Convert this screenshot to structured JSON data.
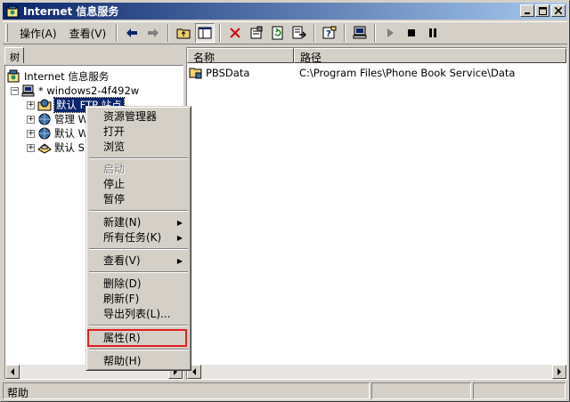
{
  "window": {
    "title": "Internet 信息服务",
    "controls": {
      "minimize": "_",
      "maximize": "□",
      "close": "×"
    }
  },
  "menu": [
    {
      "label": "操作(A)"
    },
    {
      "label": "查看(V)"
    }
  ],
  "toolbar": {
    "icons": [
      "back-arrow-icon",
      "forward-arrow-icon",
      "up-folder-icon",
      "show-tree-icon",
      "delete-icon",
      "properties-icon",
      "refresh-icon",
      "export-list-icon",
      "help-icon",
      "computer-icon",
      "play-icon",
      "stop-icon",
      "pause-icon"
    ]
  },
  "tree_pane": {
    "tab_label": "树",
    "nodes": [
      {
        "label": "Internet 信息服务"
      },
      {
        "label": "* windows2-4f492w"
      },
      {
        "label": "默认 FTP 站点"
      },
      {
        "label": "管理 W"
      },
      {
        "label": "默认 W"
      },
      {
        "label": "默认 S"
      }
    ]
  },
  "list_pane": {
    "columns": [
      "名称",
      "路径"
    ],
    "rows": [
      {
        "name": "PBSData",
        "path": "C:\\Program Files\\Phone Book Service\\Data"
      }
    ]
  },
  "context_menu": {
    "items": [
      {
        "label": "资源管理器"
      },
      {
        "label": "打开"
      },
      {
        "label": "浏览"
      },
      {
        "label": "启动",
        "disabled": true
      },
      {
        "label": "停止"
      },
      {
        "label": "暂停"
      },
      {
        "label": "新建(N)",
        "submenu": true
      },
      {
        "label": "所有任务(K)",
        "submenu": true
      },
      {
        "label": "查看(V)",
        "submenu": true
      },
      {
        "label": "删除(D)"
      },
      {
        "label": "刷新(F)"
      },
      {
        "label": "导出列表(L)..."
      },
      {
        "label": "属性(R)",
        "highlighted": true
      },
      {
        "label": "帮助(H)"
      }
    ],
    "submenu_arrow": "▶"
  },
  "status_bar": {
    "text": "帮助"
  },
  "colors": {
    "titlebar_start": "#0a246a",
    "titlebar_end": "#a6caf0",
    "selection": "#0a246a",
    "highlight_box": "#e02020",
    "face": "#d4d0c8"
  }
}
